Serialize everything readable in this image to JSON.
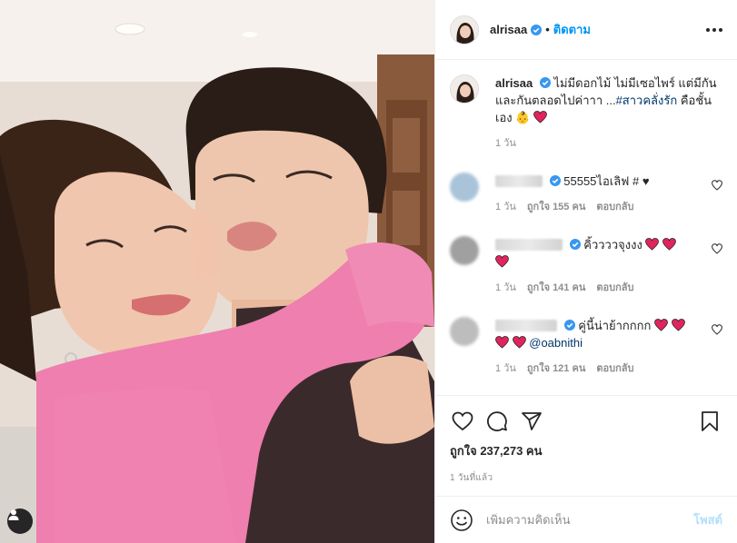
{
  "header": {
    "username": "alrisaa",
    "separator": "•",
    "follow_label": "ติดตาม"
  },
  "caption": {
    "username": "alrisaa",
    "text": "ไม่มีดอกไม้ ไม่มีเซอไพร์ แต่มีกันและกันตลอดไปค่าาา ...",
    "hashtag": "#สาวคลั่งรัก",
    "tail": " คือชั้นเอง ",
    "emoji": "👶",
    "time": "1 วัน"
  },
  "comments": [
    {
      "text": "55555ไอเลิฟ # ♥",
      "time": "1 วัน",
      "likes": "ถูกใจ 155 คน",
      "reply": "ตอบกลับ",
      "avatar_color": "#a9c3d8"
    },
    {
      "text": "คิ้ววววจุงงง",
      "time": "1 วัน",
      "likes": "ถูกใจ 141 คน",
      "reply": "ตอบกลับ",
      "avatar_color": "#a0a0a0"
    },
    {
      "text": "คู่นี้น่าย้ากกกก",
      "mention": "@oabnithi",
      "time": "1 วัน",
      "likes": "ถูกใจ 121 คน",
      "reply": "ตอบกลับ",
      "avatar_color": "#bdbdbd"
    }
  ],
  "actions": {
    "likes_count": "ถูกใจ 237,273 คน",
    "posted_time": "1 วันที่แล้ว"
  },
  "add_comment": {
    "placeholder": "เพิ่มความคิดเห็น",
    "post_label": "โพสต์"
  },
  "colors": {
    "accent": "#0095f6",
    "verified": "#3897f0",
    "heart_red": "#e0245e",
    "link": "#00376b"
  }
}
